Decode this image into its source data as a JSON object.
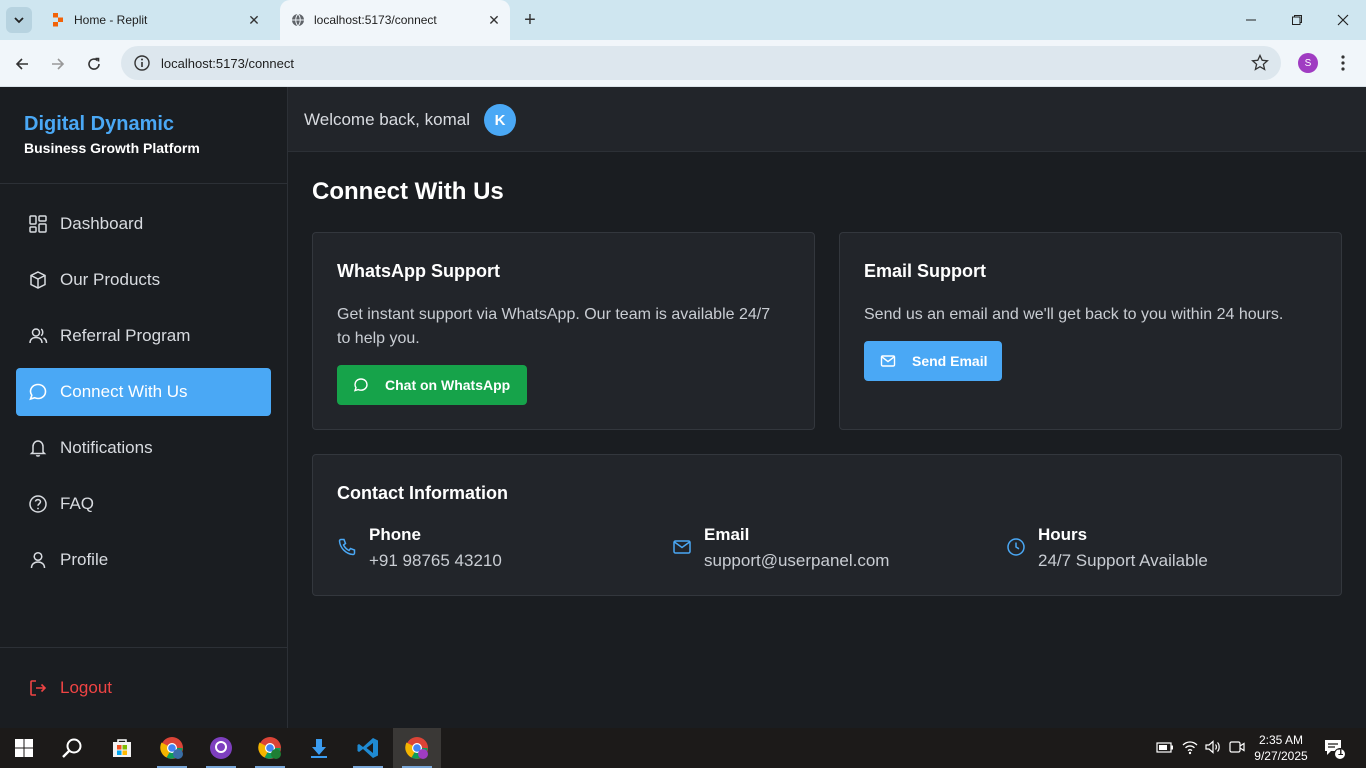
{
  "browser": {
    "tabs": [
      {
        "title": "Home - Replit",
        "active": false
      },
      {
        "title": "localhost:5173/connect",
        "active": true
      }
    ],
    "url": "localhost:5173/connect",
    "profile_initial": "S"
  },
  "sidebar": {
    "brand_title": "Digital Dynamic",
    "brand_subtitle": "Business Growth Platform",
    "items": [
      {
        "label": "Dashboard",
        "icon": "dashboard-icon"
      },
      {
        "label": "Our Products",
        "icon": "package-icon"
      },
      {
        "label": "Referral Program",
        "icon": "users-icon"
      },
      {
        "label": "Connect With Us",
        "icon": "message-circle-icon",
        "active": true
      },
      {
        "label": "Notifications",
        "icon": "bell-icon"
      },
      {
        "label": "FAQ",
        "icon": "help-circle-icon"
      },
      {
        "label": "Profile",
        "icon": "user-icon"
      }
    ],
    "logout_label": "Logout"
  },
  "header": {
    "welcome": "Welcome back, komal",
    "avatar_initial": "K"
  },
  "main": {
    "title": "Connect With Us",
    "whatsapp": {
      "title": "WhatsApp Support",
      "description": "Get instant support via WhatsApp. Our team is available 24/7 to help you.",
      "button": "Chat on WhatsApp"
    },
    "email": {
      "title": "Email Support",
      "description": "Send us an email and we'll get back to you within 24 hours.",
      "button": "Send Email"
    },
    "contact": {
      "title": "Contact Information",
      "items": [
        {
          "label": "Phone",
          "value": "+91 98765 43210",
          "icon": "phone-icon"
        },
        {
          "label": "Email",
          "value": "support@userpanel.com",
          "icon": "mail-icon"
        },
        {
          "label": "Hours",
          "value": "24/7 Support Available",
          "icon": "clock-icon"
        }
      ]
    }
  },
  "colors": {
    "accent": "#4aa8f5",
    "whatsapp_green": "#16a34a",
    "logout_red": "#ef4444",
    "background": "#1a1d21",
    "card": "#22252a"
  },
  "taskbar": {
    "time": "2:35 AM",
    "date": "9/27/2025",
    "notification_count": "1"
  }
}
